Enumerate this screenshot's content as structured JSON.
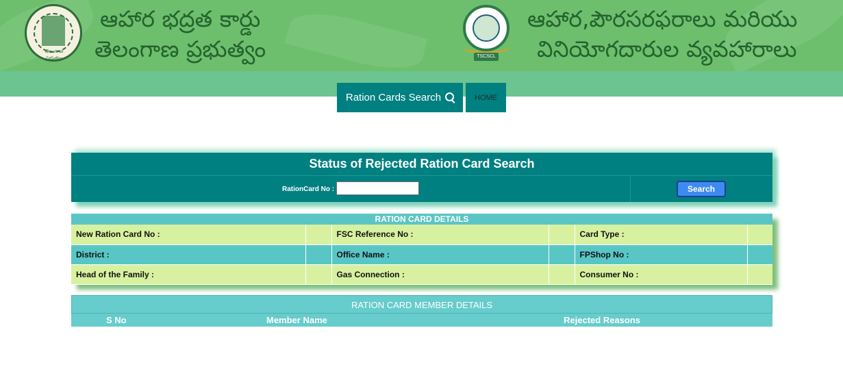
{
  "header": {
    "title_left_line1": "ఆహార భద్రత కార్డు",
    "title_left_line2": "తెలంగాణ ప్రభుత్వం",
    "emblem_text": "తెలంగాణ ప్రభుత్వం",
    "title_right_line1": "ఆహార,పౌరసరఫరాలు మరియు",
    "title_right_line2": "వినియోగదారుల వ్యవహారాలు",
    "logo_label": "TSCSCL"
  },
  "nav": {
    "search_label": "Ration Cards Search",
    "home_label": "HOME"
  },
  "search": {
    "title": "Status of Rejected Ration Card Search",
    "rc_label": "RationCard No :",
    "rc_value": "",
    "button_label": "Search"
  },
  "details": {
    "header": "RATION CARD DETAILS",
    "rows": [
      {
        "c1": "New Ration Card No :",
        "c2": "FSC Reference No :",
        "c3": "Card Type :"
      },
      {
        "c1": "District :",
        "c2": "Office Name :",
        "c3": "FPShop No :"
      },
      {
        "c1": "Head of the Family :",
        "c2": "Gas Connection :",
        "c3": "Consumer No :"
      }
    ]
  },
  "members": {
    "header": "RATION CARD MEMBER DETAILS",
    "col_sno": "S No",
    "col_name": "Member Name",
    "col_reason": "Rejected Reasons"
  },
  "colors": {
    "header_green": "#6dbf6d",
    "teal": "#008080",
    "light_teal": "#59c6c6",
    "light_green": "#d8f1a0",
    "button_blue": "#3d8bf0"
  }
}
